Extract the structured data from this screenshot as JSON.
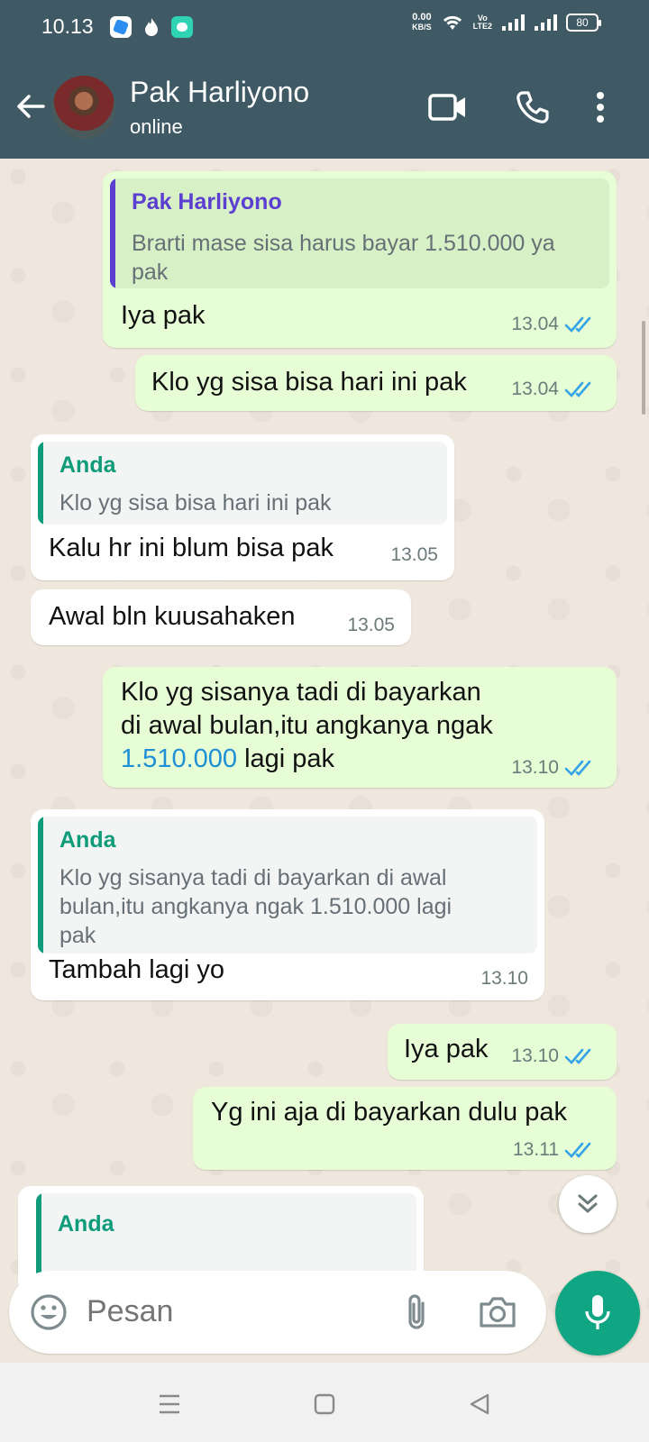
{
  "status_bar": {
    "time": "10.13",
    "net_speed_value": "0.00",
    "net_speed_unit": "KB/S",
    "volte_top": "Vo",
    "volte_bottom": "LTE2",
    "battery": "80"
  },
  "header": {
    "contact_name": "Pak Harliyono",
    "contact_status": "online"
  },
  "messages": [
    {
      "direction": "outgoing",
      "quote": {
        "author": "Pak Harliyono",
        "text": "Brarti mase sisa harus bayar 1.510.000 ya pak"
      },
      "text": "Iya pak",
      "time": "13.04",
      "status": "read"
    },
    {
      "direction": "outgoing",
      "text": "Klo yg sisa bisa hari ini pak",
      "time": "13.04",
      "status": "read"
    },
    {
      "direction": "incoming",
      "quote": {
        "author": "Anda",
        "text": "Klo yg sisa bisa hari ini pak"
      },
      "text": "Kalu hr ini blum bisa pak",
      "time": "13.05"
    },
    {
      "direction": "incoming",
      "text": "Awal bln kuusahaken",
      "time": "13.05"
    },
    {
      "direction": "outgoing",
      "text_line1": "Klo yg sisanya tadi di bayarkan",
      "text_line2": "di awal bulan,itu angkanya ngak",
      "text_link": "1.510.000",
      "text_tail": "lagi pak",
      "time": "13.10",
      "status": "read"
    },
    {
      "direction": "incoming",
      "quote": {
        "author": "Anda",
        "text_line1": "Klo yg sisanya tadi di bayarkan di awal",
        "text_line2": "bulan,itu angkanya ngak 1.510.000 lagi",
        "text_line3": "pak"
      },
      "text": "Tambah lagi yo",
      "time": "13.10"
    },
    {
      "direction": "outgoing",
      "text": "Iya pak",
      "time": "13.10",
      "status": "read"
    },
    {
      "direction": "outgoing",
      "text": "Yg ini aja di bayarkan dulu pak",
      "time": "13.11",
      "status": "read"
    },
    {
      "direction": "incoming",
      "quote": {
        "author": "Anda"
      }
    }
  ],
  "input": {
    "placeholder": "Pesan"
  },
  "icons": [
    "back-arrow-icon",
    "video-call-icon",
    "phone-icon",
    "more-options-icon",
    "emoji-icon",
    "attach-icon",
    "camera-icon",
    "mic-icon",
    "scroll-down-icon",
    "read-ticks-icon",
    "wifi-icon",
    "signal-icon",
    "battery-icon",
    "nav-menu-icon",
    "nav-home-icon",
    "nav-back-icon"
  ],
  "colors": {
    "header": "#3f5a64",
    "outgoing_bubble": "#e6fdd5",
    "incoming_bubble": "#ffffff",
    "accent_green": "#11a683",
    "quote_contact": "#5b3fd1",
    "quote_self": "#0e9b7a",
    "ticks": "#34a3e8"
  }
}
